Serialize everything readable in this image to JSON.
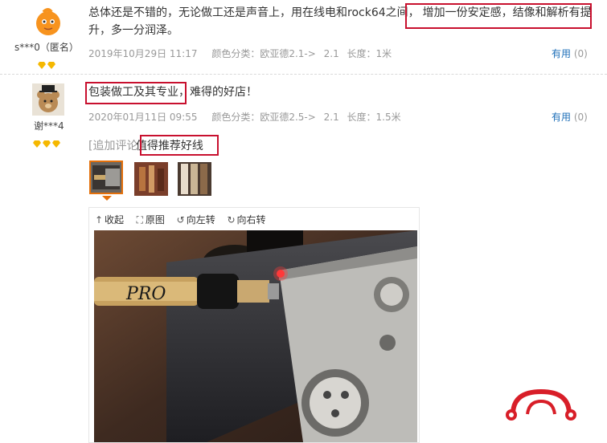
{
  "reviews": [
    {
      "username": "s***0（匿名）",
      "text_before": "总体还是不错的，无论做工还是声音上，用在线电和rock64之间，",
      "highlight": "增加一份安定感，结像和解析有提",
      "text_after": "升，多一分润泽。",
      "date": "2019年10月29日 11:17",
      "color_label": "颜色分类：欧亚德2.1->",
      "length_value": "2.1",
      "length_label": "长度：1米",
      "useful_label": "有用",
      "useful_count": "(0)"
    },
    {
      "username": "谢***4",
      "highlight": "包装做工及其专业",
      "text_after": "，难得的好店！",
      "date": "2020年01月11日 09:55",
      "color_label": "颜色分类：欧亚德2.5->",
      "length_value": "2.1",
      "length_label": "长度：1.5米",
      "useful_label": "有用",
      "useful_count": "(0)",
      "append_label": "[追加评论]",
      "append_text": "值得推荐好线"
    }
  ],
  "viewer": {
    "collapse": "收起",
    "original": "原图",
    "rotate_left": "向左转",
    "rotate_right": "向右转",
    "photo_text": "PRO"
  },
  "colors": {
    "highlight_border": "#c8102e",
    "useful_link": "#1e6fb8",
    "selected_thumb": "#e4700b",
    "gem": "#f5b800"
  }
}
